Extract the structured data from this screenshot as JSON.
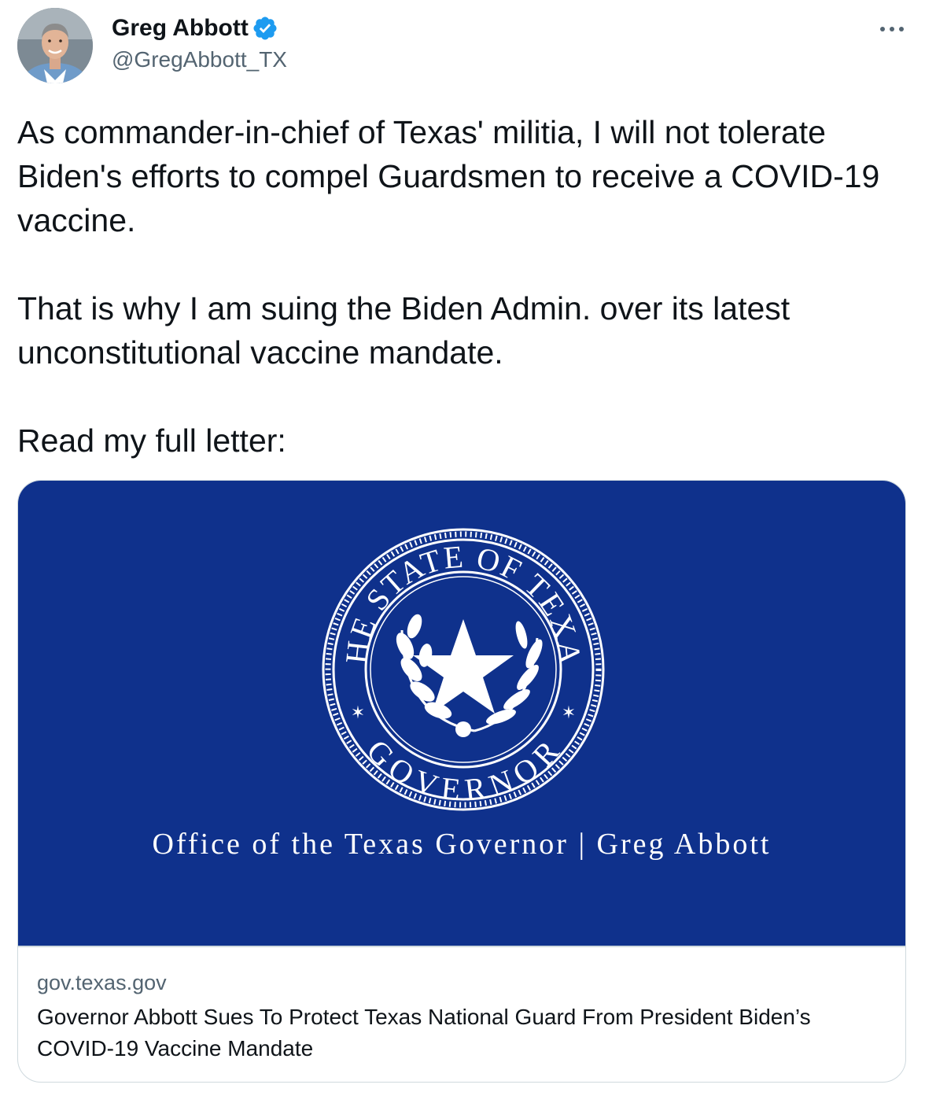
{
  "author": {
    "name": "Greg Abbott",
    "handle": "@GregAbbott_TX",
    "verified": true,
    "avatar_icon": "profile-photo"
  },
  "menu": {
    "more_icon": "more-horizontal-icon",
    "more_label": "···"
  },
  "tweet": {
    "paragraphs": [
      "As commander-in-chief of Texas' militia, I will not tolerate Biden's efforts to compel Guardsmen to receive a COVID-19 vaccine.",
      "That is why I am suing the Biden Admin. over its latest unconstitutional vaccine mandate.",
      "Read my full letter:"
    ]
  },
  "card": {
    "image": {
      "seal_top_text": "THE STATE OF TEXAS",
      "seal_bottom_text": "GOVERNOR",
      "caption": "Office of the Texas Governor | Greg Abbott",
      "background_color": "#0f318c"
    },
    "domain": "gov.texas.gov",
    "title": "Governor Abbott Sues To Protect Texas National Guard From President Biden’s COVID-19 Vaccine Mandate"
  },
  "colors": {
    "text_primary": "#0f1419",
    "text_secondary": "#536471",
    "verified_blue": "#1d9bf0",
    "border": "#cfd9de"
  }
}
